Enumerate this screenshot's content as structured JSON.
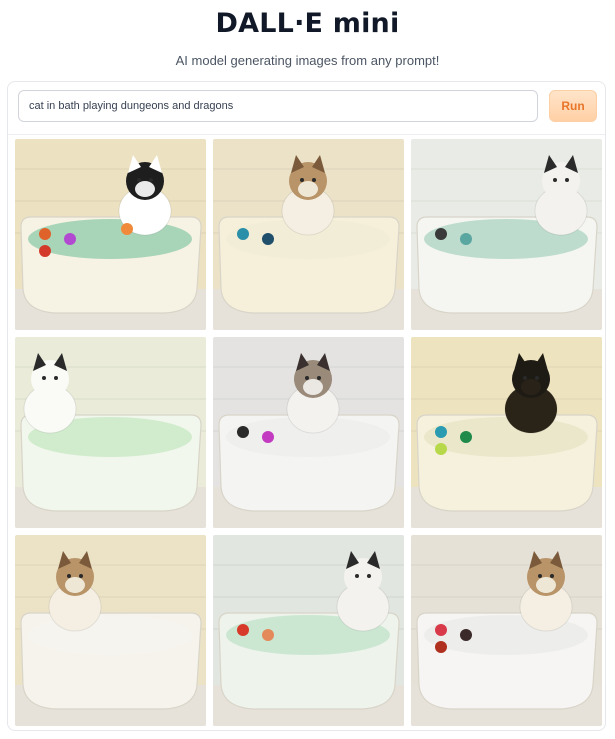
{
  "header": {
    "title": "DALL·E mini",
    "subtitle": "AI model generating images from any prompt!"
  },
  "prompt": {
    "value": "cat in bath playing dungeons and dragons",
    "run_label": "Run"
  },
  "results": [
    {
      "wall": "#ece1c0",
      "tub": "#f7f3e4",
      "water": "#9fd0b2",
      "cat": "bw",
      "dice": [
        "#e0622b",
        "#b14ad1",
        "#d33a2a",
        "#f08a3a"
      ]
    },
    {
      "wall": "#ebe2c8",
      "tub": "#f6f0da",
      "water": "#f2ecd6",
      "cat": "tabby",
      "dice": [
        "#2a8fa8",
        "#1f4f6a"
      ]
    },
    {
      "wall": "#e9ece6",
      "tub": "#f5f6f2",
      "water": "#b7d9c9",
      "cat": "calico",
      "dice": [
        "#3a3a3a",
        "#5aa6a0"
      ]
    },
    {
      "wall": "#eaecd9",
      "tub": "#f2f7ee",
      "water": "#cdeac9",
      "cat": "white",
      "dice": []
    },
    {
      "wall": "#e4e3e1",
      "tub": "#f4f4f2",
      "water": "#eeeeec",
      "cat": "tabbywhite",
      "dice": [
        "#2a2a2a",
        "#c23bc0"
      ]
    },
    {
      "wall": "#eee3bf",
      "tub": "#f6f1dc",
      "water": "#e9e6c9",
      "cat": "black",
      "dice": [
        "#2a9bb0",
        "#1f8a4a",
        "#b7d84a"
      ]
    },
    {
      "wall": "#ece3c7",
      "tub": "#f5f3ec",
      "water": "#f6f4ee",
      "cat": "tabby",
      "dice": []
    },
    {
      "wall": "#e2e6e0",
      "tub": "#eef3ec",
      "water": "#c6e5cf",
      "cat": "calico",
      "dice": [
        "#d83a2a",
        "#e48a5a"
      ]
    },
    {
      "wall": "#e6e1d6",
      "tub": "#f6f5f3",
      "water": "#ececea",
      "cat": "tabby",
      "dice": [
        "#d83a4a",
        "#3a2a2a",
        "#b03020"
      ]
    }
  ]
}
